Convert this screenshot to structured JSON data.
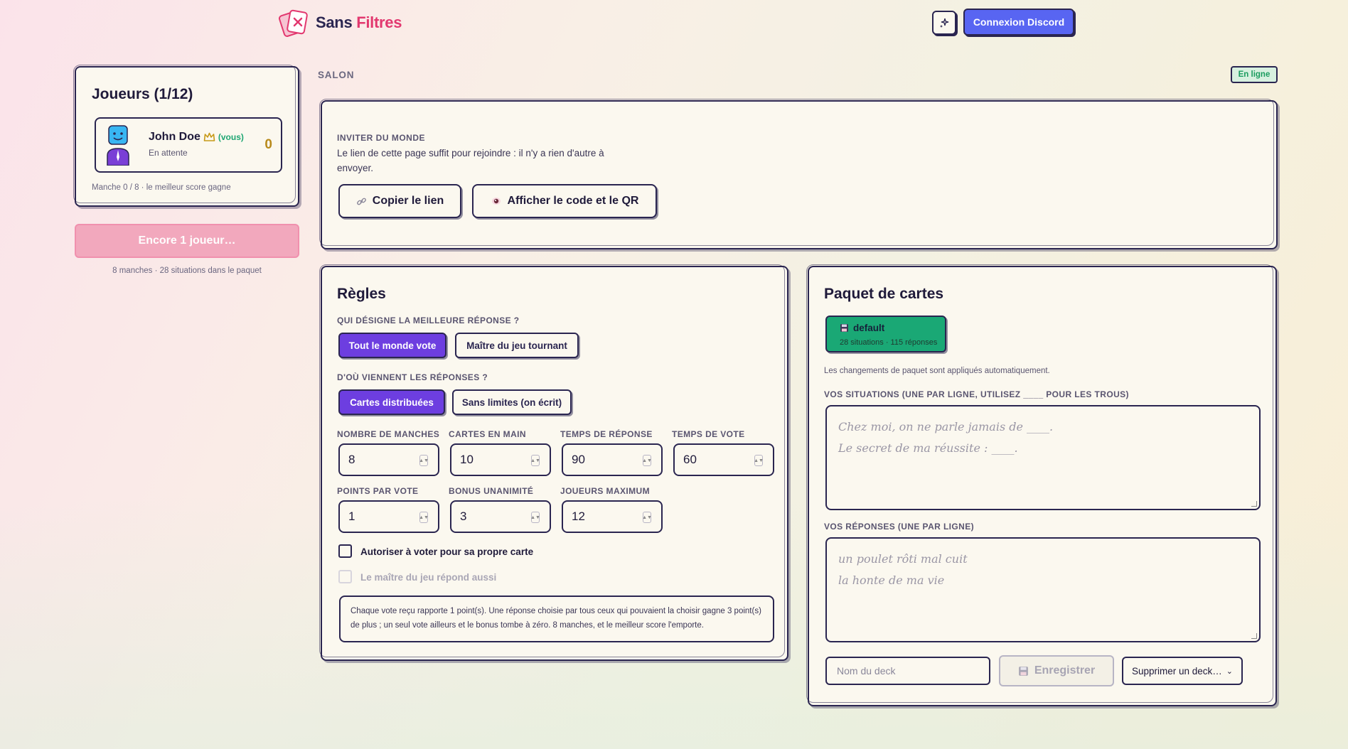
{
  "header": {
    "brand_part1": "Sans",
    "brand_part2": "Filtres",
    "theme_button_icon": "sparkle-icon",
    "discord_label": "Connexion Discord"
  },
  "players": {
    "title": "Joueurs (1/12)",
    "list": [
      {
        "name": "John Doe",
        "you_label": "(vous)",
        "status": "En attente",
        "score": "0"
      }
    ],
    "round_info": "Manche 0 / 8 · le meilleur score gagne",
    "waiting_button": "Encore 1 joueur…",
    "deck_info": "8 manches · 28 situations dans le paquet"
  },
  "salon": {
    "label": "SALON",
    "status": "En ligne",
    "invite_label": "INVITER DU MONDE",
    "invite_text": "Le lien de cette page suffit pour rejoindre : il n'y a rien d'autre à envoyer.",
    "copy_button": "Copier le lien",
    "qr_button": "Afficher le code et le QR"
  },
  "rules": {
    "title": "Règles",
    "q1_label": "QUI DÉSIGNE LA MEILLEURE RÉPONSE ?",
    "q1_options": [
      "Tout le monde vote",
      "Maître du jeu tournant"
    ],
    "q2_label": "D'OÙ VIENNENT LES RÉPONSES ?",
    "q2_options": [
      "Cartes distribuées",
      "Sans limites (on écrit)"
    ],
    "fields": [
      {
        "label": "NOMBRE DE MANCHES",
        "value": "8"
      },
      {
        "label": "CARTES EN MAIN",
        "value": "10"
      },
      {
        "label": "TEMPS DE RÉPONSE",
        "value": "90"
      },
      {
        "label": "TEMPS DE VOTE",
        "value": "60"
      },
      {
        "label": "POINTS PAR VOTE",
        "value": "1"
      },
      {
        "label": "BONUS UNANIMITÉ",
        "value": "3"
      },
      {
        "label": "JOUEURS MAXIMUM",
        "value": "12"
      }
    ],
    "check_self_vote": "Autoriser à voter pour sa propre carte",
    "check_master_answers": "Le maître du jeu répond aussi",
    "summary": "Chaque vote reçu rapporte 1 point(s). Une réponse choisie par tous ceux qui pouvaient la choisir gagne 3 point(s) de plus ; un seul vote ailleurs et le bonus tombe à zéro. 8 manches, et le meilleur score l'emporte."
  },
  "deck": {
    "title": "Paquet de cartes",
    "chip_name": "default",
    "chip_sub": "28 situations · 115 réponses",
    "note": "Les changements de paquet sont appliqués automatiquement.",
    "situations_label": "VOS SITUATIONS (UNE PAR LIGNE, UTILISEZ ____ POUR LES TROUS)",
    "situations_placeholder": [
      "Chez moi, on ne parle jamais de ____.",
      "Le secret de ma réussite : ____."
    ],
    "answers_label": "VOS RÉPONSES (UNE PAR LIGNE)",
    "answers_placeholder": [
      "un poulet rôti mal cuit",
      "la honte de ma vie"
    ],
    "deckname_placeholder": "Nom du deck",
    "save_button": "Enregistrer",
    "delete_select": "Supprimer un deck…"
  },
  "colors": {
    "accent": "#6d3ee0",
    "discord": "#5865f2",
    "brand_pink": "#e2386f",
    "deck_green": "#1aa875"
  }
}
